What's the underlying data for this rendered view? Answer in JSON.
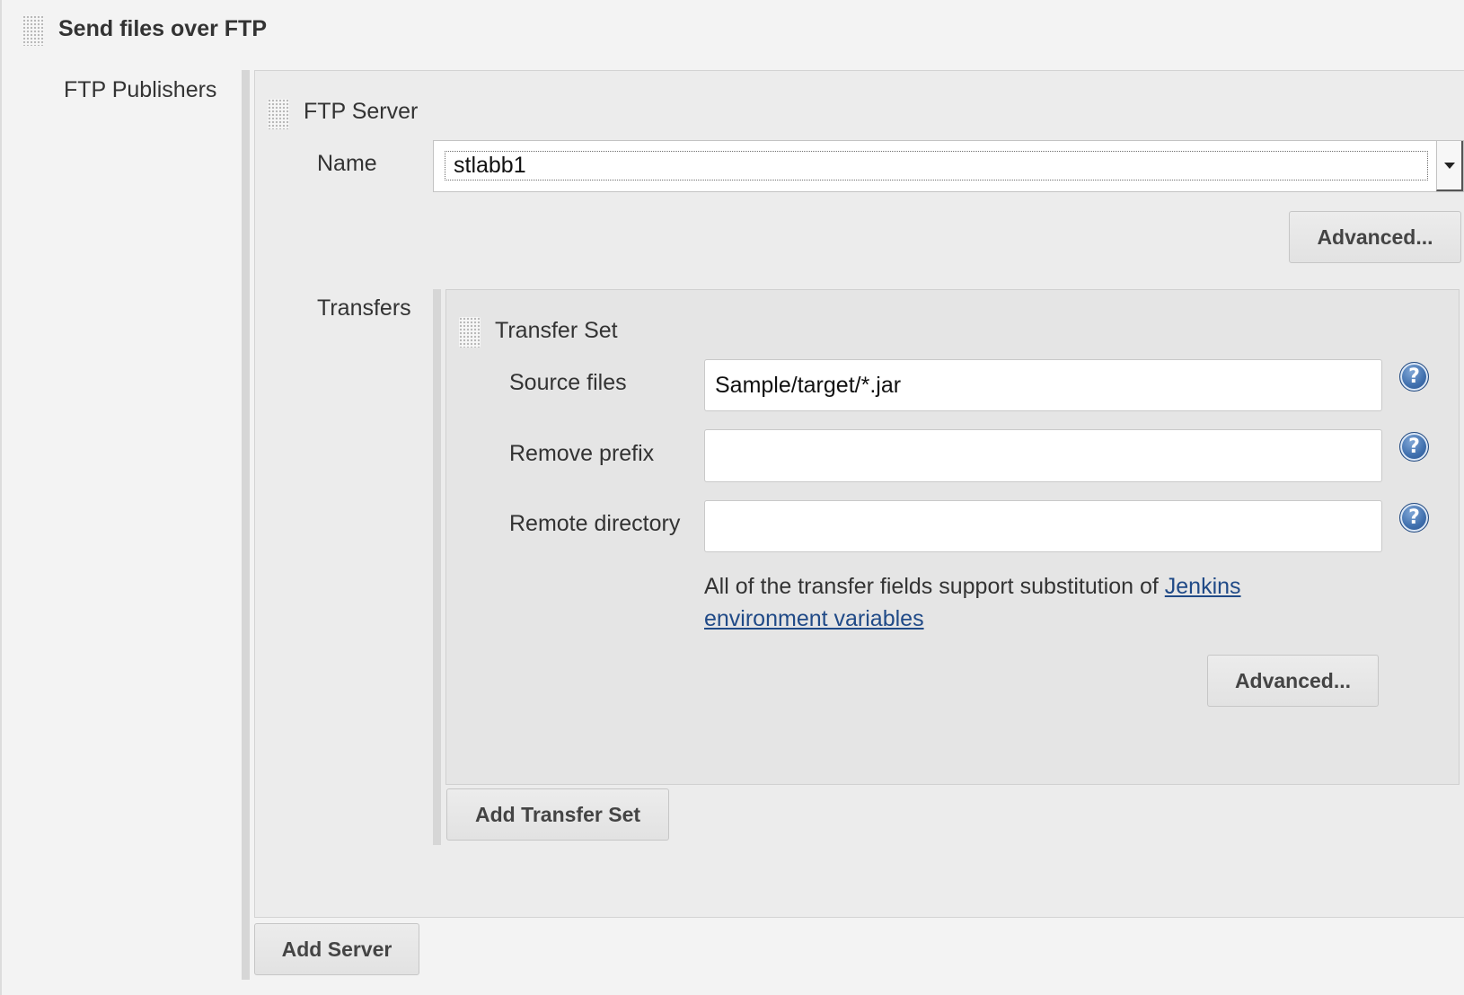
{
  "section": {
    "title": "Send files over FTP"
  },
  "publishers": {
    "label": "FTP Publishers",
    "server": {
      "title": "FTP Server",
      "name_label": "Name",
      "name_value": "stlabb1",
      "advanced_label": "Advanced...",
      "transfers_label": "Transfers",
      "transfer_set": {
        "title": "Transfer Set",
        "source_files_label": "Source files",
        "source_files_value": "Sample/target/*.jar",
        "remove_prefix_label": "Remove prefix",
        "remove_prefix_value": "",
        "remote_directory_label": "Remote directory",
        "remote_directory_value": "",
        "info_text": "All of the transfer fields support substitution of ",
        "info_link": "Jenkins environment variables",
        "advanced_label": "Advanced...",
        "help_icon_text": "?"
      },
      "add_transfer_set_label": "Add Transfer Set"
    },
    "add_server_label": "Add Server"
  }
}
